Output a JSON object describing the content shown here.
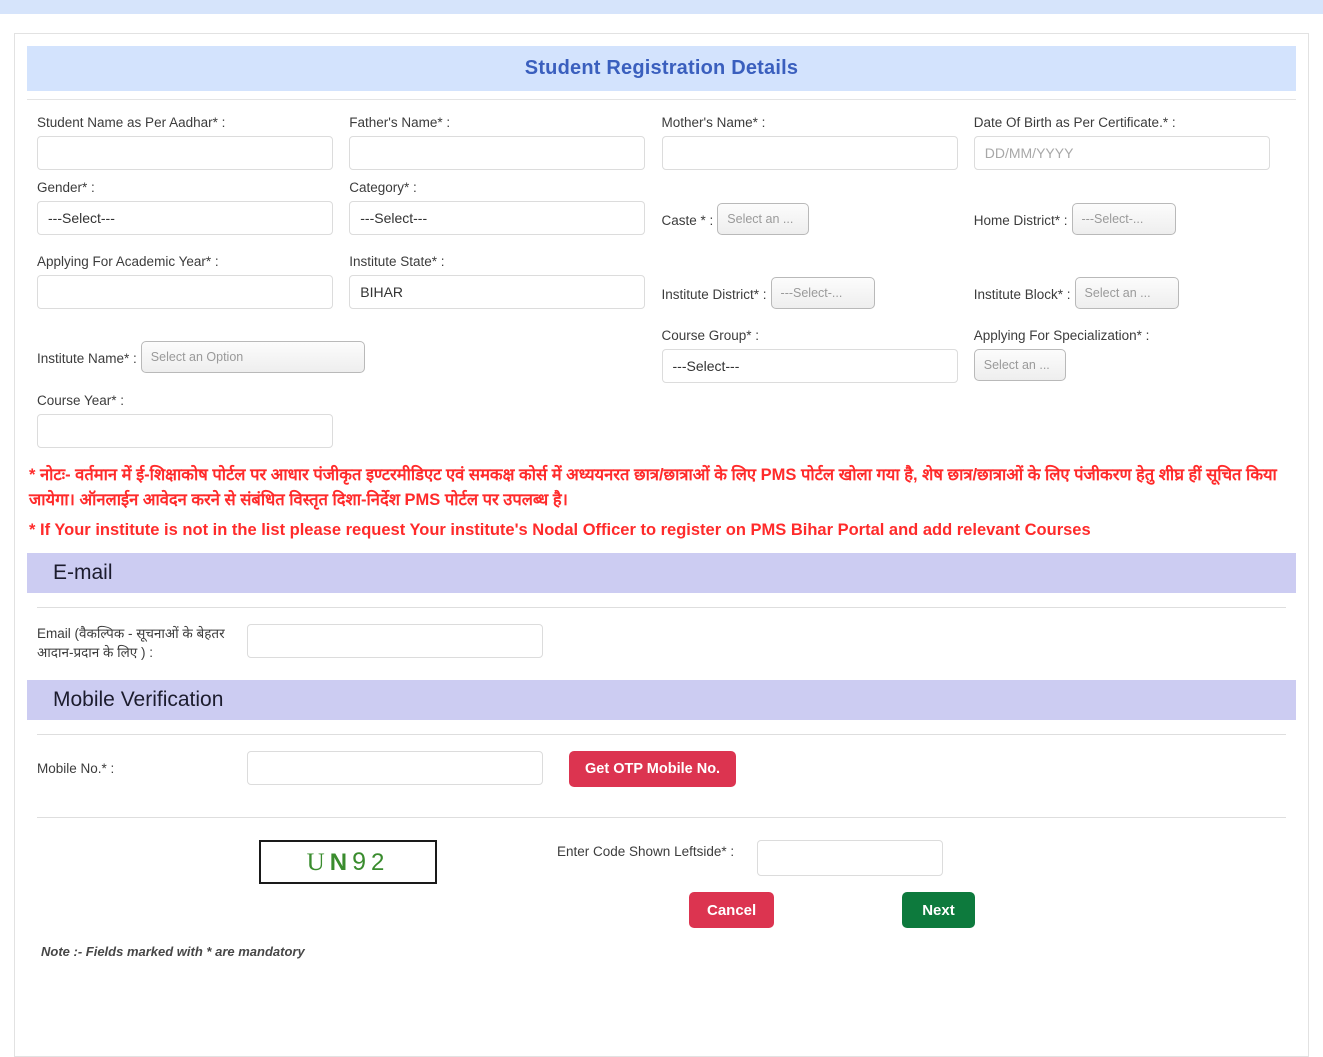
{
  "page": {
    "title": "Student Registration Details"
  },
  "topstrip": {
    "text": ""
  },
  "form": {
    "rows": [
      {
        "fields": [
          {
            "kind": "input",
            "label": "Student Name as Per Aadhar* :",
            "value": "",
            "placeholder": ""
          },
          {
            "kind": "input",
            "label": "Father's Name* :",
            "value": "",
            "placeholder": ""
          },
          {
            "kind": "input",
            "label": "Mother's Name* :",
            "value": "",
            "placeholder": ""
          },
          {
            "kind": "input",
            "label": "Date Of Birth as Per Certificate.* :",
            "value": "",
            "placeholder": "DD/MM/YYYY"
          }
        ]
      },
      {
        "fields": [
          {
            "kind": "select",
            "label": "Gender* :",
            "value": "---Select---"
          },
          {
            "kind": "select",
            "label": "Category* :",
            "value": "---Select---"
          },
          {
            "kind": "btn",
            "label": "Caste * :",
            "value": "Select an ...",
            "size": "small"
          },
          {
            "kind": "btn",
            "label": "Home District* :",
            "value": "---Select-...",
            "size": "mid"
          }
        ]
      },
      {
        "fields": [
          {
            "kind": "input",
            "label": "Applying For Academic Year* :",
            "value": "",
            "placeholder": ""
          },
          {
            "kind": "input",
            "label": "Institute State* :",
            "value": "BIHAR",
            "placeholder": ""
          },
          {
            "kind": "btn",
            "label": "Institute District* :",
            "value": "---Select-...",
            "size": "mid"
          },
          {
            "kind": "btn",
            "label": "Institute Block* :",
            "value": "Select an ...",
            "size": "small"
          }
        ]
      },
      {
        "fields": [
          {
            "kind": "btn",
            "label": "Institute Name* :",
            "value": "Select an Option",
            "size": "wide"
          },
          {
            "kind": "empty",
            "label": "",
            "value": ""
          },
          {
            "kind": "select",
            "label": "Course Group* :",
            "value": "---Select---"
          },
          {
            "kind": "btn2",
            "label": "Applying For Specialization* :",
            "value": "Select an ...",
            "size": "small"
          }
        ]
      },
      {
        "fields": [
          {
            "kind": "input",
            "label": "Course Year* :",
            "value": "",
            "placeholder": ""
          },
          {
            "kind": "empty",
            "label": "",
            "value": ""
          },
          {
            "kind": "empty",
            "label": "",
            "value": ""
          },
          {
            "kind": "empty",
            "label": "",
            "value": ""
          }
        ]
      }
    ]
  },
  "notices": {
    "hindi": "* नोटः- वर्तमान में ई-शिक्षाकोष पोर्टल पर आधार पंजीकृत इण्टरमीडिएट एवं समकक्ष कोर्स में अध्ययनरत छात्र/छात्राओं के लिए PMS पोर्टल खोला गया है, शेष छात्र/छात्राओं के लिए पंजीकरण हेतु शीघ्र हीं सूचित किया जायेगा। ऑनलाईन आवेदन करने से संबंधित विस्तृत दिशा-निर्देश PMS पोर्टल पर उपलब्ध है।",
    "english": "* If Your institute is not in the list please request Your institute's Nodal Officer to register on PMS Bihar Portal and add relevant Courses"
  },
  "email_section": {
    "heading": "E-mail",
    "label": "Email (वैकल्पिक - सूचनाओं के बेहतर आदान-प्रदान के लिए ) :",
    "value": "",
    "placeholder": ""
  },
  "mobile_section": {
    "heading": "Mobile Verification",
    "label": "Mobile No.* :",
    "value": "",
    "placeholder": "",
    "otp_button": "Get OTP Mobile No."
  },
  "captcha": {
    "code": "UN92",
    "chars": [
      "U",
      "N",
      "9",
      "2"
    ],
    "label": "Enter Code Shown Leftside* :",
    "value": "",
    "placeholder": ""
  },
  "actions": {
    "cancel": "Cancel",
    "next": "Next"
  },
  "footer": {
    "note": "Note :- Fields marked with * are mandatory"
  },
  "colors": {
    "title_bar": "#d3e3fd",
    "title_text": "#3a5fbe",
    "section_bar": "#ccccf2",
    "notice_red": "#ff2b2b",
    "danger": "#dc3450",
    "success": "#0d7a3d",
    "captcha_green": "#3a8c2e"
  }
}
